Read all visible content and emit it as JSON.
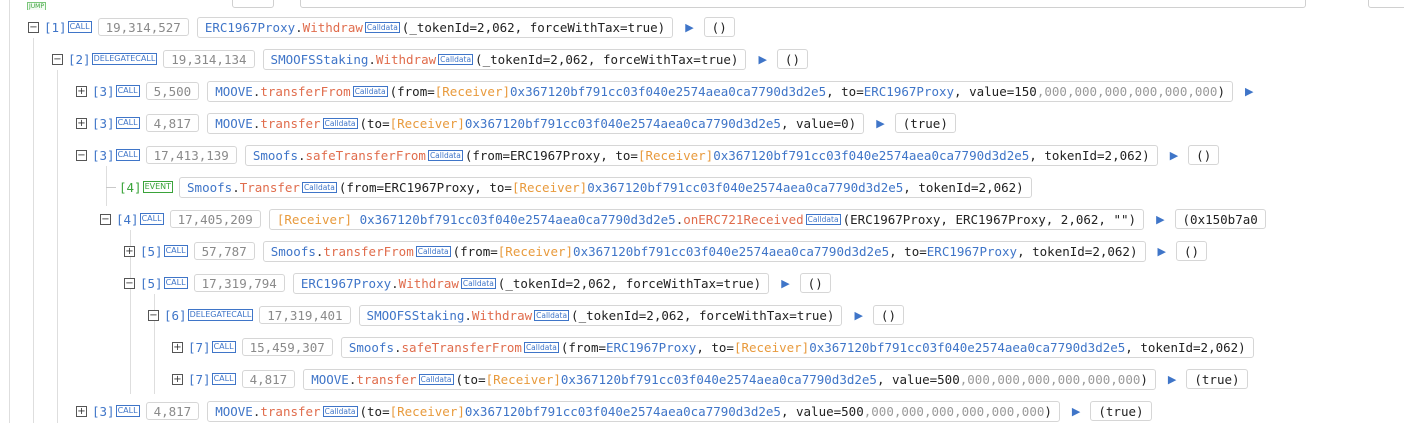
{
  "top_badge": "JUMP",
  "labels": {
    "call": "CALL",
    "delegatecall": "DELEGATECALL",
    "event": "EVENT",
    "calldata": "Calldata",
    "receiver": "[Receiver]"
  },
  "icons": {
    "expand": "plus-box-icon",
    "collapse": "minus-box-icon",
    "run": "play-triangle-icon"
  },
  "colors": {
    "contract": "#3f75c8",
    "method": "#e06c4c",
    "receiver": "#e89a3c",
    "event": "#3aa33a",
    "dim": "#9a9a9a"
  },
  "trace": [
    {
      "depth": "[1]",
      "gas": "19,314,527",
      "contract": "ERC1967Proxy",
      "method": "Withdraw",
      "args_a": "(_tokenId=2,062, forceWithTax=true)",
      "ret": "()"
    },
    {
      "depth": "[2]",
      "gas": "19,314,134",
      "contract": "SMOOFSStaking",
      "method": "Withdraw",
      "args_a": "(_tokenId=2,062, forceWithTax=true)",
      "ret": "()"
    },
    {
      "depth": "[3]",
      "gas": "5,500",
      "contract": "MOOVE",
      "method": "transferFrom",
      "args_a": "(from=",
      "addr1": "0x367120bf791cc03f040e2574aea0ca7790d3d2e5",
      "args_b": ", to=",
      "to_contract": "ERC1967Proxy",
      "args_c": ", value=150",
      "zeros": ",000,000,000,000,000,000",
      "args_d": ")"
    },
    {
      "depth": "[3]",
      "gas": "4,817",
      "contract": "MOOVE",
      "method": "transfer",
      "args_a": "(to=",
      "addr1": "0x367120bf791cc03f040e2574aea0ca7790d3d2e5",
      "args_b": ", value=0)",
      "ret": "(true)"
    },
    {
      "depth": "[3]",
      "gas": "17,413,139",
      "contract": "Smoofs",
      "method": "safeTransferFrom",
      "args_a": "(from=ERC1967Proxy, to=",
      "addr1": "0x367120bf791cc03f040e2574aea0ca7790d3d2e5",
      "args_b": ", tokenId=2,062)",
      "ret": "()"
    },
    {
      "depth": "[4]",
      "contract": "Smoofs",
      "method": "Transfer",
      "args_a": "(from=ERC1967Proxy, to=",
      "addr1": "0x367120bf791cc03f040e2574aea0ca7790d3d2e5",
      "args_b": ", tokenId=2,062)"
    },
    {
      "depth": "[4]",
      "gas": "17,405,209",
      "addr0": "0x367120bf791cc03f040e2574aea0ca7790d3d2e5",
      "method": "onERC721Received",
      "args_a": "(ERC1967Proxy, ERC1967Proxy, 2,062, \"\")",
      "ret": "(0x150b7a0"
    },
    {
      "depth": "[5]",
      "gas": "57,787",
      "contract": "Smoofs",
      "method": "transferFrom",
      "args_a": "(from=",
      "addr1": "0x367120bf791cc03f040e2574aea0ca7790d3d2e5",
      "args_b": ", to=",
      "to_contract": "ERC1967Proxy",
      "args_c": ", tokenId=2,062)",
      "ret": "()"
    },
    {
      "depth": "[5]",
      "gas": "17,319,794",
      "contract": "ERC1967Proxy",
      "method": "Withdraw",
      "args_a": "(_tokenId=2,062, forceWithTax=true)",
      "ret": "()"
    },
    {
      "depth": "[6]",
      "gas": "17,319,401",
      "contract": "SMOOFSStaking",
      "method": "Withdraw",
      "args_a": "(_tokenId=2,062, forceWithTax=true)",
      "ret": "()"
    },
    {
      "depth": "[7]",
      "gas": "15,459,307",
      "contract": "Smoofs",
      "method": "safeTransferFrom",
      "args_a": "(from=",
      "from_contract": "ERC1967Proxy",
      "args_b": ", to=",
      "addr1": "0x367120bf791cc03f040e2574aea0ca7790d3d2e5",
      "args_c": ", tokenId=2,062)"
    },
    {
      "depth": "[7]",
      "gas": "4,817",
      "contract": "MOOVE",
      "method": "transfer",
      "args_a": "(to=",
      "addr1": "0x367120bf791cc03f040e2574aea0ca7790d3d2e5",
      "args_b": ", value=500",
      "zeros": ",000,000,000,000,000,000",
      "args_c": ")",
      "ret": "(true)"
    },
    {
      "depth": "[3]",
      "gas": "4,817",
      "contract": "MOOVE",
      "method": "transfer",
      "args_a": "(to=",
      "addr1": "0x367120bf791cc03f040e2574aea0ca7790d3d2e5",
      "args_b": ", value=500",
      "zeros": ",000,000,000,000,000,000",
      "args_c": ")",
      "ret": "(true)"
    }
  ]
}
